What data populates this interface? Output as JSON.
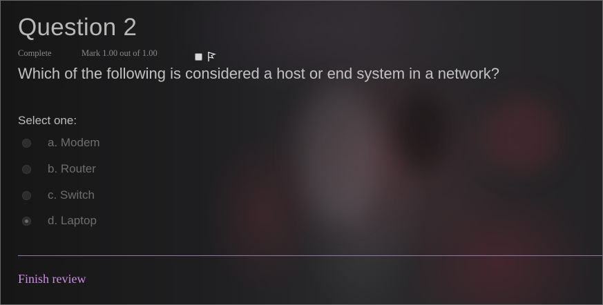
{
  "question": {
    "title": "Question 2",
    "state": "Complete",
    "mark": "Mark 1.00 out of 1.00",
    "flag_icon": "flag-icon",
    "text": "Which of the following is considered a host or end system in a network?"
  },
  "answers": {
    "prompt": "Select one:",
    "selected_index": 3,
    "options": [
      {
        "label": "a. Modem",
        "checked": false
      },
      {
        "label": "b. Router",
        "checked": false
      },
      {
        "label": "c. Switch",
        "checked": false
      },
      {
        "label": "d. Laptop",
        "checked": true
      }
    ]
  },
  "footer": {
    "finish_label": "Finish review"
  },
  "colors": {
    "link": "#c98fe0",
    "divider": "#8f7aa3",
    "title": "#b8b8b8",
    "option_text": "#6e6e6e"
  }
}
